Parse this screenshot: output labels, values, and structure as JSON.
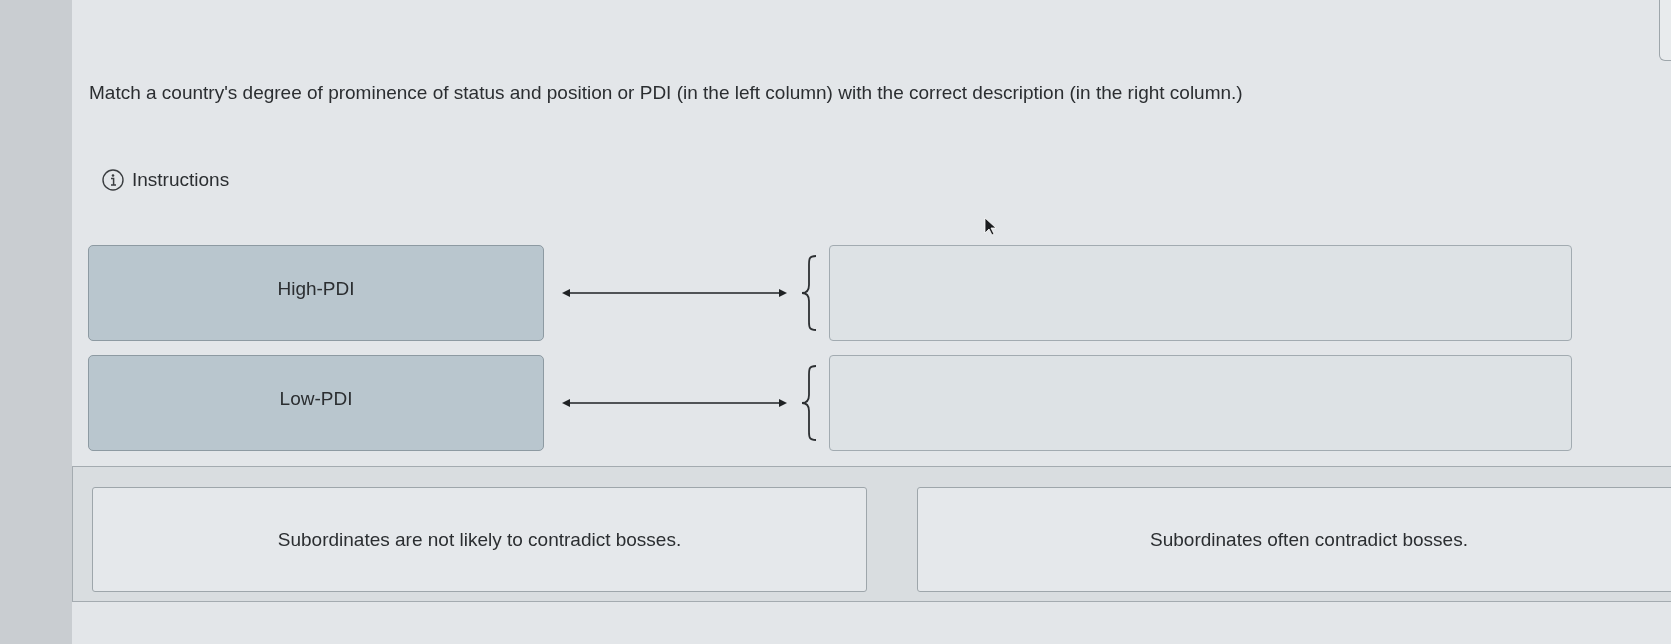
{
  "question": {
    "prompt": "Match a country's degree of prominence of status and position or PDI (in the left column) with the correct description (in the right column.)",
    "instructions": "Instructions"
  },
  "pairs": [
    {
      "label": "High-PDI"
    },
    {
      "label": "Low-PDI"
    }
  ],
  "answer_bank": {
    "choices": [
      "Subordinates are not likely to contradict bosses.",
      "Subordinates often contradict bosses."
    ]
  }
}
